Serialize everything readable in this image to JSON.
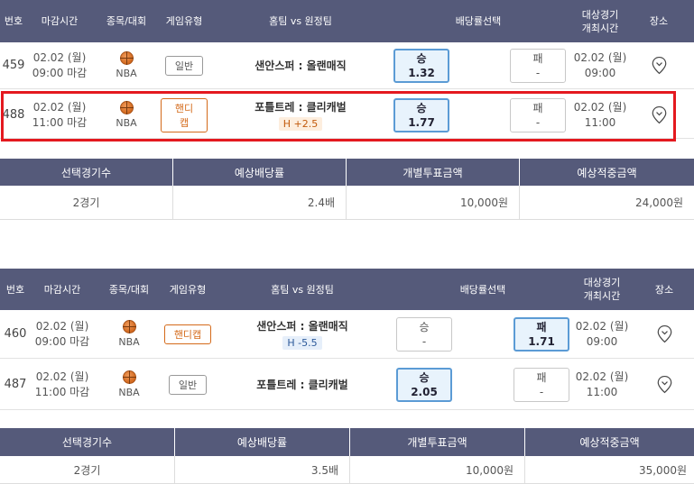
{
  "table1": {
    "header": {
      "no": "번호",
      "deadline": "마감시간",
      "sport": "종목/대회",
      "game_type": "게임유형",
      "matchup": "홈팀 vs 원정팀",
      "odds_select": "배당률선택",
      "match_time_line1": "대상경기",
      "match_time_line2": "개최시간",
      "venue": "장소"
    },
    "rows": [
      {
        "no": "459",
        "date": "02.02 (월)",
        "deadline": "09:00 마감",
        "league": "NBA",
        "type": "일반",
        "type_style": "normal",
        "teams": "샌안스퍼 : 올랜매직",
        "handicap": "",
        "win_label": "승",
        "win_odds": "1.32",
        "win_selected": true,
        "lose_label": "패",
        "lose_odds": "-",
        "lose_selected": false,
        "match_date": "02.02 (월)",
        "match_time": "09:00",
        "pin_icon": "location-pin-icon"
      },
      {
        "no": "488",
        "date": "02.02 (월)",
        "deadline": "11:00 마감",
        "league": "NBA",
        "type": "핸디캡",
        "type_style": "handicap",
        "teams": "포틀트레 : 클리캐벌",
        "handicap": "H +2.5",
        "win_label": "승",
        "win_odds": "1.77",
        "win_selected": true,
        "lose_label": "패",
        "lose_odds": "-",
        "lose_selected": false,
        "match_date": "02.02 (월)",
        "match_time": "11:00",
        "pin_icon": "location-pin-icon"
      }
    ]
  },
  "summary1": {
    "headers": {
      "count": "선택경기수",
      "odds": "예상배당률",
      "bet": "개별투표금액",
      "payout": "예상적중금액"
    },
    "values": {
      "count": "2경기",
      "odds": "2.4배",
      "bet": "10,000원",
      "payout": "24,000원"
    }
  },
  "table2": {
    "header": {
      "no": "번호",
      "deadline": "마감시간",
      "sport": "종목/대회",
      "game_type": "게임유형",
      "matchup": "홈팀 vs 원정팀",
      "odds_select": "배당률선택",
      "match_time_line1": "대상경기",
      "match_time_line2": "개최시간",
      "venue": "장소"
    },
    "rows": [
      {
        "no": "460",
        "date": "02.02 (월)",
        "deadline": "09:00 마감",
        "league": "NBA",
        "type": "핸디캡",
        "type_style": "handicap",
        "teams": "샌안스퍼 : 올랜매직",
        "handicap": "H -5.5",
        "win_label": "승",
        "win_odds": "-",
        "win_selected": false,
        "lose_label": "패",
        "lose_odds": "1.71",
        "lose_selected": true,
        "match_date": "02.02 (월)",
        "match_time": "09:00",
        "pin_icon": "location-pin-icon"
      },
      {
        "no": "487",
        "date": "02.02 (월)",
        "deadline": "11:00 마감",
        "league": "NBA",
        "type": "일반",
        "type_style": "normal",
        "teams": "포틀트레 : 클리캐벌",
        "handicap": "",
        "win_label": "승",
        "win_odds": "2.05",
        "win_selected": true,
        "lose_label": "패",
        "lose_odds": "-",
        "lose_selected": false,
        "match_date": "02.02 (월)",
        "match_time": "11:00",
        "pin_icon": "location-pin-icon"
      }
    ]
  },
  "summary2": {
    "headers": {
      "count": "선택경기수",
      "odds": "예상배당률",
      "bet": "개별투표금액",
      "payout": "예상적중금액"
    },
    "values": {
      "count": "2경기",
      "odds": "3.5배",
      "bet": "10,000원",
      "payout": "35,000원"
    }
  },
  "colors": {
    "header_bg": "#555a7a",
    "selected_odds_bg": "#e8f3fc",
    "selected_odds_border": "#5b9bd5",
    "highlight_border": "#e4191f",
    "handicap_orange": "#d46a1a"
  }
}
